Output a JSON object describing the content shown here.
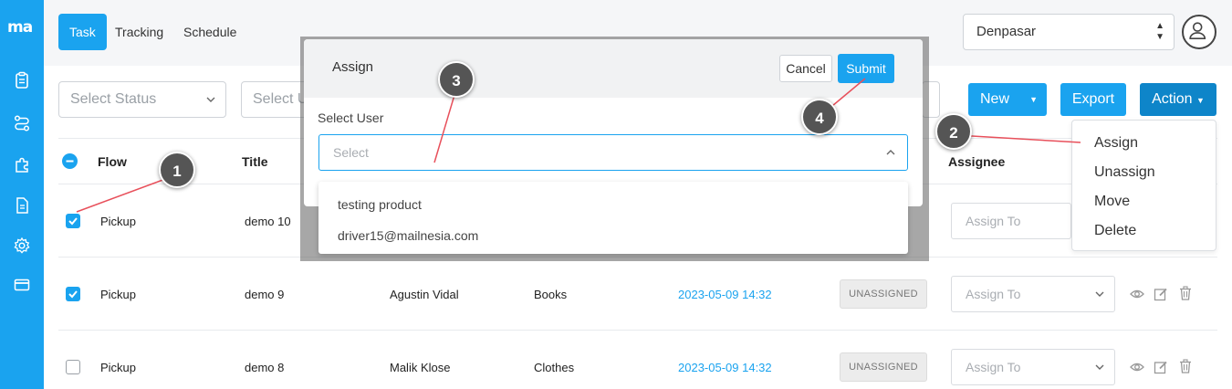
{
  "app": {
    "logo": "ma"
  },
  "tabs": [
    {
      "label": "Task",
      "active": true
    },
    {
      "label": "Tracking",
      "active": false
    },
    {
      "label": "Schedule",
      "active": false
    }
  ],
  "location_select": {
    "value": "Denpasar"
  },
  "filters": {
    "status_placeholder": "Select Status",
    "user_placeholder": "Select U"
  },
  "toolbar": {
    "new_label": "New",
    "export_label": "Export",
    "action_label": "Action"
  },
  "table": {
    "headers": {
      "flow": "Flow",
      "title": "Title",
      "assignee": "Assignee"
    },
    "rows": [
      {
        "checked": true,
        "flow": "Pickup",
        "title": "demo 10",
        "name": "",
        "category": "",
        "date": "",
        "status": "",
        "assign_placeholder": "Assign To"
      },
      {
        "checked": true,
        "flow": "Pickup",
        "title": "demo 9",
        "name": "Agustin Vidal",
        "category": "Books",
        "date": "2023-05-09 14:32",
        "status": "UNASSIGNED",
        "assign_placeholder": "Assign To"
      },
      {
        "checked": false,
        "flow": "Pickup",
        "title": "demo 8",
        "name": "Malik Klose",
        "category": "Clothes",
        "date": "2023-05-09 14:32",
        "status": "UNASSIGNED",
        "assign_placeholder": "Assign To"
      }
    ]
  },
  "action_menu": {
    "items": [
      "Assign",
      "Unassign",
      "Move",
      "Delete"
    ]
  },
  "modal": {
    "title": "Assign",
    "cancel_label": "Cancel",
    "submit_label": "Submit",
    "field_label": "Select User",
    "select_placeholder": "Select",
    "options": [
      "testing product",
      "driver15@mailnesia.com"
    ]
  },
  "annotations": [
    "1",
    "2",
    "3",
    "4"
  ],
  "colors": {
    "primary": "#1aa3ef",
    "action": "#0e85c9",
    "annotation_line": "#e8505b",
    "annotation_pin": "#555555"
  }
}
